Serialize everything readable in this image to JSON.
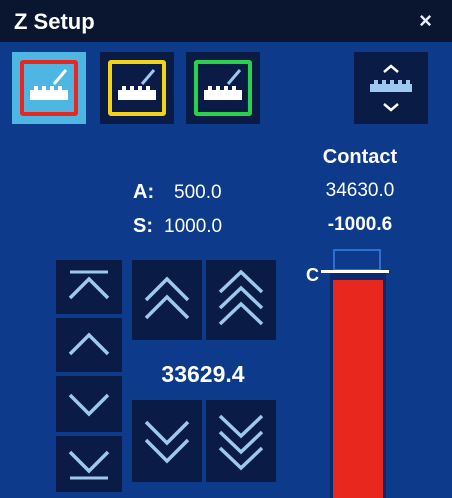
{
  "window": {
    "title": "Z Setup",
    "close_glyph": "×"
  },
  "modes": [
    {
      "icon": "probe-plate-red-icon",
      "color": "#e8271f",
      "selected": true
    },
    {
      "icon": "probe-plate-yellow-icon",
      "color": "#f2d21b",
      "selected": false
    },
    {
      "icon": "probe-plate-green-icon",
      "color": "#27d24a",
      "selected": false
    }
  ],
  "zoom_icon": "expand-vertical-icon",
  "contact": {
    "heading": "Contact",
    "value": "34630.0",
    "offset": "-1000.6"
  },
  "params": {
    "a_label": "A:",
    "a_value": "500.0",
    "s_label": "S:",
    "s_value": "1000.0"
  },
  "jog": {
    "position": "33629.4",
    "buttons": [
      "move-to-top-icon",
      "step-up-icon",
      "step-down-icon",
      "move-to-bottom-icon",
      "fast-up-icon",
      "faster-up-icon",
      "fast-down-icon",
      "faster-down-icon"
    ]
  },
  "bar": {
    "label": "C",
    "fill_color": "#e8271f"
  },
  "colors": {
    "panel": "#0d3a8a",
    "titlebar": "#0a1530",
    "button": "#0a1c45",
    "selected": "#4eb6e2",
    "icon": "#9fc8f0"
  }
}
